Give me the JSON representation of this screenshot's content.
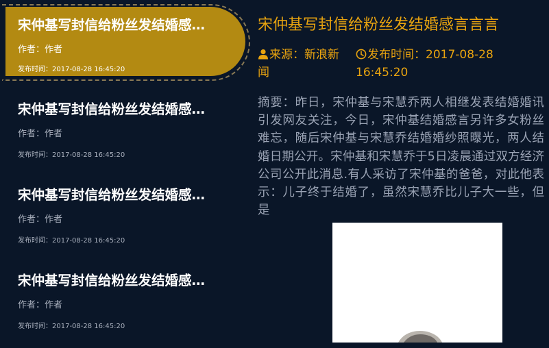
{
  "news_list": [
    {
      "title": "宋仲基写封信给粉丝发结婚感言言",
      "author": "作者：作者",
      "time": "发布时间：2017-08-28 16:45:20"
    },
    {
      "title": "宋仲基写封信给粉丝发结婚感言言",
      "author": "作者：作者",
      "time": "发布时间：2017-08-28 16:45:20"
    },
    {
      "title": "宋仲基写封信给粉丝发结婚感言言",
      "author": "作者：作者",
      "time": "发布时间：2017-08-28 16:45:20"
    },
    {
      "title": "宋仲基写封信给粉丝发结婚感言言",
      "author": "作者：作者",
      "time": "发布时间：2017-08-28 16:45:20"
    }
  ],
  "detail": {
    "title": "宋仲基写封信给粉丝发结婚感言言言",
    "source_line1": "来源：新浪新",
    "source_line2": "闻",
    "publish_line1": "发布时间：2017-08-28",
    "publish_line2": "16:45:20",
    "summary": "摘要：昨日，宋仲基与宋慧乔两人相继发表结婚婚讯引发网友关注，今日，宋仲基结婚感言另许多女粉丝难忘，随后宋仲基与宋慧乔结婚婚纱照曝光，两人结婚日期公开。宋仲基和宋慧乔于5日凌晨通过双方经济公司公开此消息.有人采访了宋仲基的爸爸，对此他表示：儿子终于结婚了，虽然宋慧乔比儿子大一些，但是"
  },
  "colors": {
    "background": "#0a1628",
    "accent": "#e9a40f",
    "active_item": "#b38a12"
  },
  "icons": {
    "source": "user-icon",
    "publish": "clock-icon"
  }
}
